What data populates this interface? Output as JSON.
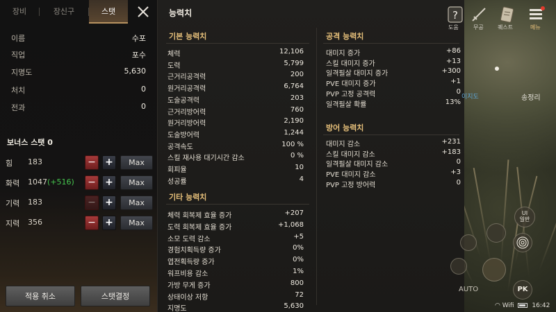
{
  "tabs": [
    {
      "label": "장비"
    },
    {
      "label": "장신구"
    },
    {
      "label": "스탯"
    }
  ],
  "close_icon": "close-icon",
  "profile": [
    {
      "key": "이름",
      "value": "수포"
    },
    {
      "key": "직업",
      "value": "포수"
    },
    {
      "key": "지명도",
      "value": "5,630"
    },
    {
      "key": "처치",
      "value": "0"
    },
    {
      "key": "전과",
      "value": "0"
    }
  ],
  "bonus": {
    "title": "보너스 스탯 0",
    "stats": [
      {
        "name": "힘",
        "value": "183",
        "extra": ""
      },
      {
        "name": "화력",
        "value": "1047",
        "extra": "(+516)"
      },
      {
        "name": "기력",
        "value": "183",
        "extra": ""
      },
      {
        "name": "지력",
        "value": "356",
        "extra": ""
      }
    ],
    "minus": "−",
    "plus": "+",
    "max": "Max"
  },
  "buttons": {
    "cancel": "적용 취소",
    "confirm": "스탯결정"
  },
  "ability": {
    "title": "능력치",
    "basic": {
      "title": "기본 능력치",
      "rows": [
        {
          "k": "체력",
          "v": "12,106"
        },
        {
          "k": "도력",
          "v": "5,799"
        },
        {
          "k": "근거리공격력",
          "v": "200"
        },
        {
          "k": "원거리공격력",
          "v": "6,764"
        },
        {
          "k": "도술공격력",
          "v": "203"
        },
        {
          "k": "근거리방어력",
          "v": "760"
        },
        {
          "k": "원거리방어력",
          "v": "2,190"
        },
        {
          "k": "도술방어력",
          "v": "1,244"
        },
        {
          "k": "공격속도",
          "v": "100 %"
        },
        {
          "k": "스킬 재사용 대기시간 감소",
          "v": "0 %"
        },
        {
          "k": "회피율",
          "v": "10"
        },
        {
          "k": "성공률",
          "v": "4"
        }
      ]
    },
    "other": {
      "title": "기타 능력치",
      "rows": [
        {
          "k": "체력 회복제 효율 증가",
          "v": "+207"
        },
        {
          "k": "도력 회복제 효율 증가",
          "v": "+1,068"
        },
        {
          "k": "소모 도력 감소",
          "v": "+5"
        },
        {
          "k": "경험치획득량 증가",
          "v": "0%"
        },
        {
          "k": "엽전획득량 증가",
          "v": "0%"
        },
        {
          "k": "워프비용 감소",
          "v": "1%"
        },
        {
          "k": "가방 무게 증가",
          "v": "800"
        },
        {
          "k": "상태이상 저항",
          "v": "72"
        },
        {
          "k": "지명도",
          "v": "5,630"
        }
      ]
    },
    "attack": {
      "title": "공격 능력치",
      "rows": [
        {
          "k": "대미지 증가",
          "v": "+86"
        },
        {
          "k": "스킬 대미지 증가",
          "v": "+13"
        },
        {
          "k": "일격필살 대미지 증가",
          "v": "+300"
        },
        {
          "k": "PVE 대미지 증가",
          "v": "+1"
        },
        {
          "k": "PVP 고정 공격력",
          "v": "0"
        },
        {
          "k": "일격필살 확률",
          "v": "13%"
        }
      ]
    },
    "defense": {
      "title": "방어 능력치",
      "rows": [
        {
          "k": "대미지 감소",
          "v": "+231"
        },
        {
          "k": "스킬 대미지 감소",
          "v": "+183"
        },
        {
          "k": "일격필살 대미지 감소",
          "v": "0"
        },
        {
          "k": "PVE 대미지 감소",
          "v": "+3"
        },
        {
          "k": "PVP 고정 방어력",
          "v": "0"
        }
      ]
    }
  },
  "hud": {
    "help_label": "도움",
    "weapon_label": "무공",
    "quest_label": "퀘스트",
    "menu_label": "메뉴",
    "location": "송정리",
    "shortcut": "이지도",
    "ui_label": "UI",
    "ui_mode": "일반",
    "auto_label": "AUTO",
    "pk_label": "PK",
    "wifi": "Wifi",
    "time": "16:42",
    "accent": "#e7c07a",
    "bonus_color": "#46c64e"
  }
}
